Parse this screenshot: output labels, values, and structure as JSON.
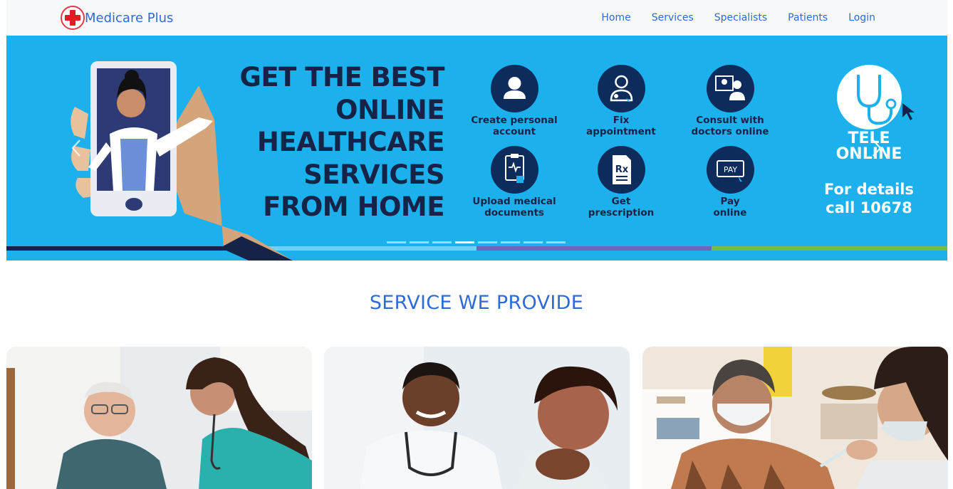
{
  "brand": {
    "name": "Medicare Plus",
    "logo_icon": "red-cross-icon"
  },
  "nav": {
    "links": [
      "Home",
      "Services",
      "Specialists",
      "Patients",
      "Login"
    ]
  },
  "carousel": {
    "headline": [
      "GET THE BEST",
      "ONLINE",
      "HEALTHCARE",
      "SERVICES",
      "FROM HOME"
    ],
    "features": [
      {
        "label": [
          "Create personal",
          "account"
        ],
        "icon": "person-icon"
      },
      {
        "label": [
          "Fix",
          "appointment"
        ],
        "icon": "doctor-icon"
      },
      {
        "label": [
          "Consult with",
          "doctors online"
        ],
        "icon": "video-consult-icon"
      },
      {
        "label": [
          "Upload medical",
          "documents"
        ],
        "icon": "clipboard-icon"
      },
      {
        "label": [
          "Get",
          "prescription"
        ],
        "icon": "prescription-icon"
      },
      {
        "label": [
          "Pay",
          "online"
        ],
        "icon": "pay-icon"
      }
    ],
    "pay_badge": "PAY",
    "rx_badge": "Rx",
    "tele_text": [
      "TELE",
      "ONLINE"
    ],
    "tele_details": [
      "For details",
      "call 10678"
    ],
    "slide_count": 8,
    "active_slide": 4,
    "colors": {
      "background": "#1cb1ec",
      "navy": "#152347",
      "icon_bg": "#0d2c5c"
    }
  },
  "services": {
    "title": "SERVICE WE PROVIDE",
    "cards": [
      {
        "image": "elderly-patient-with-nurse-photo"
      },
      {
        "image": "doctor-examining-child-photo"
      },
      {
        "image": "patient-vaccination-photo"
      }
    ]
  }
}
